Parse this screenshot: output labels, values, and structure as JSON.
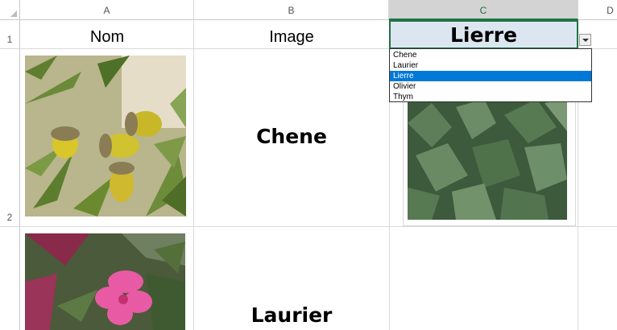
{
  "columns": [
    {
      "id": "A",
      "label": "A"
    },
    {
      "id": "B",
      "label": "B"
    },
    {
      "id": "C",
      "label": "C"
    },
    {
      "id": "D",
      "label": "D"
    }
  ],
  "rows": [
    {
      "label": "1"
    },
    {
      "label": "2"
    }
  ],
  "header": {
    "nom": "Nom",
    "image": "Image",
    "selected_value": "Lierre"
  },
  "data_rows": [
    {
      "name": "Chene",
      "image_icon": "acorn-photo-icon"
    },
    {
      "name": "Laurier",
      "image_icon": "oleander-photo-icon"
    }
  ],
  "dropdown": {
    "options": [
      "Chene",
      "Laurier",
      "Lierre",
      "Olivier",
      "Thym"
    ],
    "selected": "Lierre"
  },
  "picture_c2": {
    "image_icon": "ivy-photo-icon"
  },
  "colors": {
    "accent": "#217346",
    "selection_fill": "#dce6f1",
    "dropdown_highlight": "#0078d7"
  }
}
